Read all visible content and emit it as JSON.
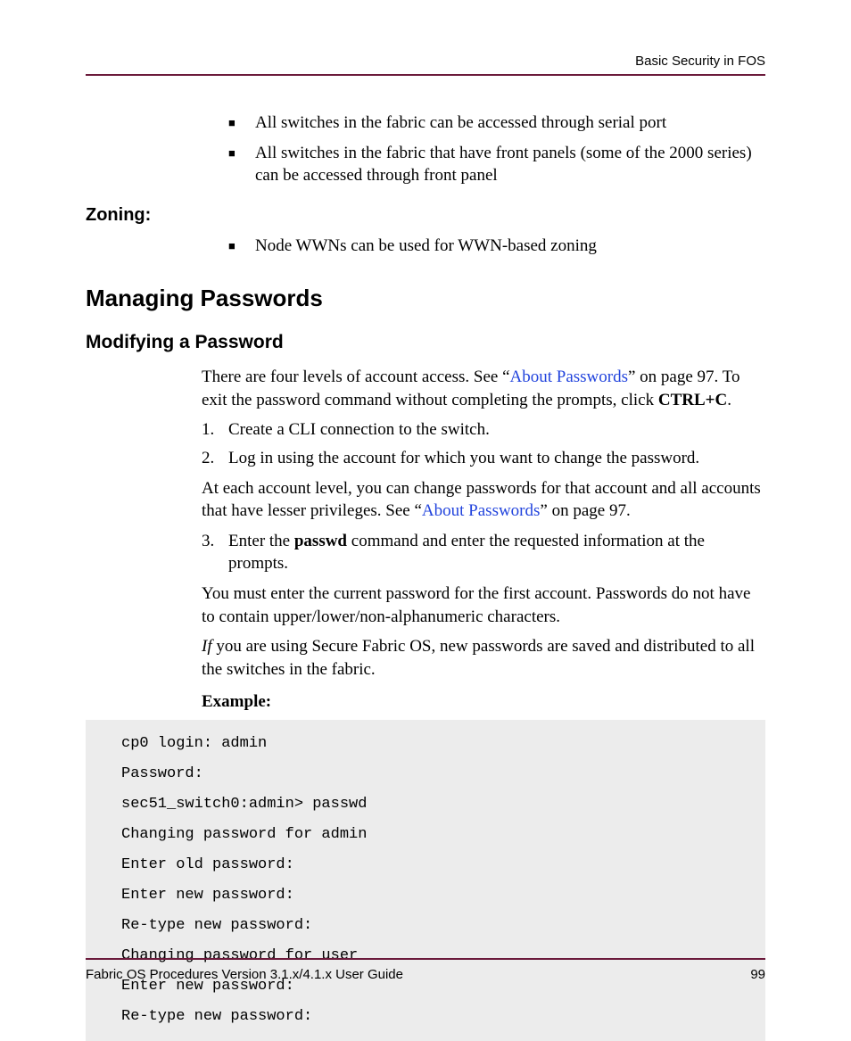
{
  "header": {
    "section_title": "Basic Security in FOS"
  },
  "bullets_top": [
    "All switches in the fabric can be accessed through serial port",
    "All switches in the fabric that have front panels (some of the 2000 series) can be accessed through front panel"
  ],
  "zoning": {
    "heading": "Zoning:",
    "bullets": [
      "Node WWNs can be used for WWN-based zoning"
    ]
  },
  "managing": {
    "heading": "Managing Passwords",
    "modifying": {
      "heading": "Modifying a Password",
      "intro": {
        "pre": "There are four levels of account access. See “",
        "link": "About Passwords",
        "mid": "” on page 97. To exit the password command without completing the prompts, click ",
        "bold": "CTRL+C",
        "post": "."
      },
      "steps12": [
        "Create a CLI connection to the switch.",
        "Log in using the account for which you want to change the password."
      ],
      "mid_para": {
        "pre": "At each account level, you can change passwords for that account and all accounts that have lesser privileges. See “",
        "link": "About Passwords",
        "post": "” on page 97."
      },
      "step3": {
        "pre": "Enter the ",
        "bold": "passwd",
        "post": " command and enter the requested information at the prompts."
      },
      "after3a": "You must enter the current password for the first account. Passwords do not have to contain upper/lower/non-alphanumeric characters.",
      "after3b": {
        "italic": "If",
        "rest": " you are using Secure Fabric OS, new passwords are saved and distributed to all the switches in the fabric."
      },
      "example_label": "Example:",
      "example_code": "cp0 login: admin\nPassword:\nsec51_switch0:admin> passwd\nChanging password for admin\nEnter old password:\nEnter new password:\nRe-type new password:\nChanging password for user\nEnter new password:\nRe-type new password:"
    }
  },
  "footer": {
    "doc_title": "Fabric OS Procedures Version 3.1.x/4.1.x User Guide",
    "page_number": "99"
  }
}
